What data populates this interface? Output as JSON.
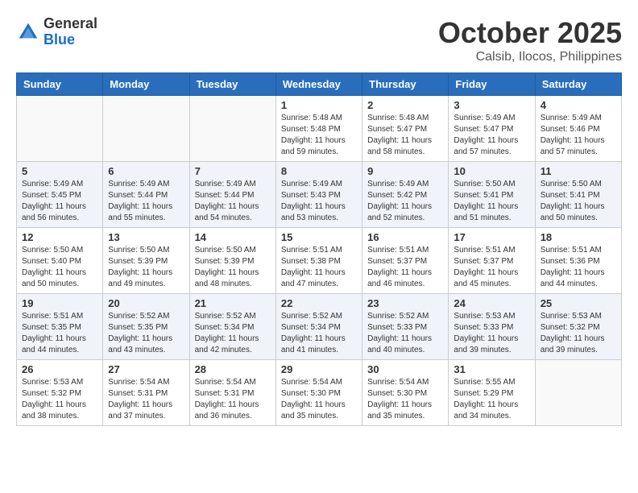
{
  "header": {
    "logo_general": "General",
    "logo_blue": "Blue",
    "month_title": "October 2025",
    "location": "Calsib, Ilocos, Philippines"
  },
  "days_of_week": [
    "Sunday",
    "Monday",
    "Tuesday",
    "Wednesday",
    "Thursday",
    "Friday",
    "Saturday"
  ],
  "weeks": [
    {
      "row_class": "normal-row",
      "days": [
        {
          "number": "",
          "empty": true
        },
        {
          "number": "",
          "empty": true
        },
        {
          "number": "",
          "empty": true
        },
        {
          "number": "1",
          "sunrise": "5:48 AM",
          "sunset": "5:48 PM",
          "daylight": "11 hours and 59 minutes."
        },
        {
          "number": "2",
          "sunrise": "5:48 AM",
          "sunset": "5:47 PM",
          "daylight": "11 hours and 58 minutes."
        },
        {
          "number": "3",
          "sunrise": "5:49 AM",
          "sunset": "5:47 PM",
          "daylight": "11 hours and 57 minutes."
        },
        {
          "number": "4",
          "sunrise": "5:49 AM",
          "sunset": "5:46 PM",
          "daylight": "11 hours and 57 minutes."
        }
      ]
    },
    {
      "row_class": "alt-row",
      "days": [
        {
          "number": "5",
          "sunrise": "5:49 AM",
          "sunset": "5:45 PM",
          "daylight": "11 hours and 56 minutes."
        },
        {
          "number": "6",
          "sunrise": "5:49 AM",
          "sunset": "5:44 PM",
          "daylight": "11 hours and 55 minutes."
        },
        {
          "number": "7",
          "sunrise": "5:49 AM",
          "sunset": "5:44 PM",
          "daylight": "11 hours and 54 minutes."
        },
        {
          "number": "8",
          "sunrise": "5:49 AM",
          "sunset": "5:43 PM",
          "daylight": "11 hours and 53 minutes."
        },
        {
          "number": "9",
          "sunrise": "5:49 AM",
          "sunset": "5:42 PM",
          "daylight": "11 hours and 52 minutes."
        },
        {
          "number": "10",
          "sunrise": "5:50 AM",
          "sunset": "5:41 PM",
          "daylight": "11 hours and 51 minutes."
        },
        {
          "number": "11",
          "sunrise": "5:50 AM",
          "sunset": "5:41 PM",
          "daylight": "11 hours and 50 minutes."
        }
      ]
    },
    {
      "row_class": "normal-row",
      "days": [
        {
          "number": "12",
          "sunrise": "5:50 AM",
          "sunset": "5:40 PM",
          "daylight": "11 hours and 50 minutes."
        },
        {
          "number": "13",
          "sunrise": "5:50 AM",
          "sunset": "5:39 PM",
          "daylight": "11 hours and 49 minutes."
        },
        {
          "number": "14",
          "sunrise": "5:50 AM",
          "sunset": "5:39 PM",
          "daylight": "11 hours and 48 minutes."
        },
        {
          "number": "15",
          "sunrise": "5:51 AM",
          "sunset": "5:38 PM",
          "daylight": "11 hours and 47 minutes."
        },
        {
          "number": "16",
          "sunrise": "5:51 AM",
          "sunset": "5:37 PM",
          "daylight": "11 hours and 46 minutes."
        },
        {
          "number": "17",
          "sunrise": "5:51 AM",
          "sunset": "5:37 PM",
          "daylight": "11 hours and 45 minutes."
        },
        {
          "number": "18",
          "sunrise": "5:51 AM",
          "sunset": "5:36 PM",
          "daylight": "11 hours and 44 minutes."
        }
      ]
    },
    {
      "row_class": "alt-row",
      "days": [
        {
          "number": "19",
          "sunrise": "5:51 AM",
          "sunset": "5:35 PM",
          "daylight": "11 hours and 44 minutes."
        },
        {
          "number": "20",
          "sunrise": "5:52 AM",
          "sunset": "5:35 PM",
          "daylight": "11 hours and 43 minutes."
        },
        {
          "number": "21",
          "sunrise": "5:52 AM",
          "sunset": "5:34 PM",
          "daylight": "11 hours and 42 minutes."
        },
        {
          "number": "22",
          "sunrise": "5:52 AM",
          "sunset": "5:34 PM",
          "daylight": "11 hours and 41 minutes."
        },
        {
          "number": "23",
          "sunrise": "5:52 AM",
          "sunset": "5:33 PM",
          "daylight": "11 hours and 40 minutes."
        },
        {
          "number": "24",
          "sunrise": "5:53 AM",
          "sunset": "5:33 PM",
          "daylight": "11 hours and 39 minutes."
        },
        {
          "number": "25",
          "sunrise": "5:53 AM",
          "sunset": "5:32 PM",
          "daylight": "11 hours and 39 minutes."
        }
      ]
    },
    {
      "row_class": "normal-row",
      "days": [
        {
          "number": "26",
          "sunrise": "5:53 AM",
          "sunset": "5:32 PM",
          "daylight": "11 hours and 38 minutes."
        },
        {
          "number": "27",
          "sunrise": "5:54 AM",
          "sunset": "5:31 PM",
          "daylight": "11 hours and 37 minutes."
        },
        {
          "number": "28",
          "sunrise": "5:54 AM",
          "sunset": "5:31 PM",
          "daylight": "11 hours and 36 minutes."
        },
        {
          "number": "29",
          "sunrise": "5:54 AM",
          "sunset": "5:30 PM",
          "daylight": "11 hours and 35 minutes."
        },
        {
          "number": "30",
          "sunrise": "5:54 AM",
          "sunset": "5:30 PM",
          "daylight": "11 hours and 35 minutes."
        },
        {
          "number": "31",
          "sunrise": "5:55 AM",
          "sunset": "5:29 PM",
          "daylight": "11 hours and 34 minutes."
        },
        {
          "number": "",
          "empty": true
        }
      ]
    }
  ]
}
